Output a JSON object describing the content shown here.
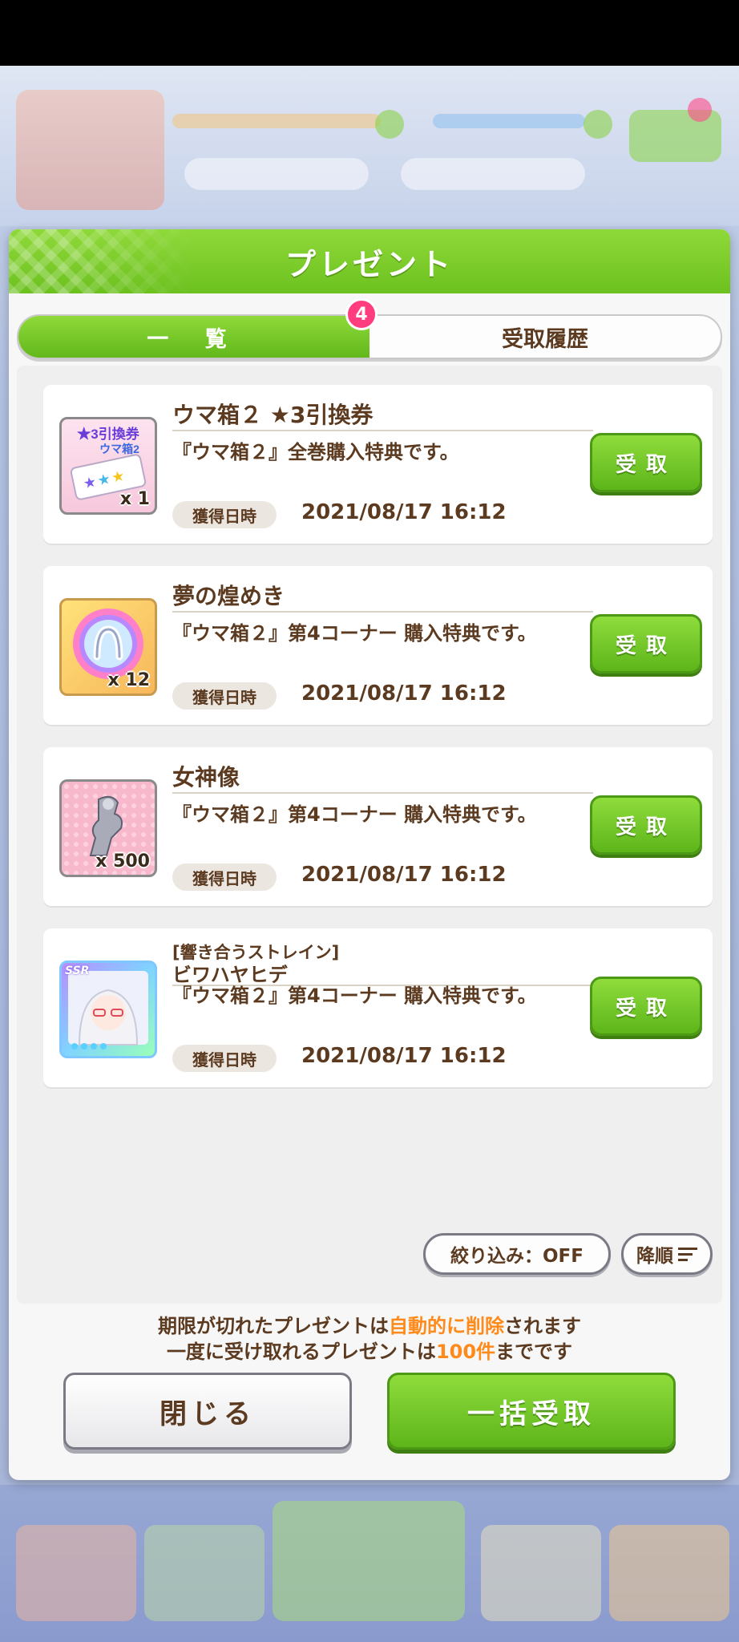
{
  "dialog": {
    "title": "プレゼント"
  },
  "tabs": {
    "list_label": "一 覧",
    "history_label": "受取履歴",
    "badge_count": "4"
  },
  "items": [
    {
      "name": "ウマ箱２ ★3引換券",
      "desc": "『ウマ箱２』全巻購入特典です。",
      "qty": "x 1",
      "date_label": "獲得日時",
      "date": "2021/08/17 16:12",
      "button": "受取",
      "icon": "ticket-icon",
      "icon_text_top": "★3引換券",
      "icon_text_sub": "ウマ箱2"
    },
    {
      "name": "夢の煌めき",
      "desc": "『ウマ箱２』第4コーナー 購入特典です。",
      "qty": "x 12",
      "date_label": "獲得日時",
      "date": "2021/08/17 16:12",
      "button": "受取",
      "icon": "horseshoe-gem-icon"
    },
    {
      "name": "女神像",
      "desc": "『ウマ箱２』第4コーナー 購入特典です。",
      "qty": "x 500",
      "date_label": "獲得日時",
      "date": "2021/08/17 16:12",
      "button": "受取",
      "icon": "goddess-statue-icon"
    },
    {
      "subname": "[響き合うストレイン]",
      "name": "ビワハヤヒデ",
      "desc": "『ウマ箱２』第4コーナー 購入特典です。",
      "date_label": "獲得日時",
      "date": "2021/08/17 16:12",
      "button": "受取",
      "icon": "ssr-card-icon",
      "rarity": "SSR"
    }
  ],
  "filter": {
    "label": "絞り込み：OFF",
    "sort_label": "降順"
  },
  "notices": {
    "line1_a": "期限が切れたプレゼントは",
    "line1_hl": "自動的に削除",
    "line1_b": "されます",
    "line2_a": "一度に受け取れるプレゼントは",
    "line2_hl": "100件",
    "line2_b": "までです"
  },
  "buttons": {
    "close": "閉じる",
    "receive_all": "一括受取"
  },
  "colors": {
    "accent_green": "#6cc11f",
    "text_brown": "#5b3a20",
    "highlight_orange": "#ff8a1a",
    "badge_pink": "#ff3d7f"
  }
}
